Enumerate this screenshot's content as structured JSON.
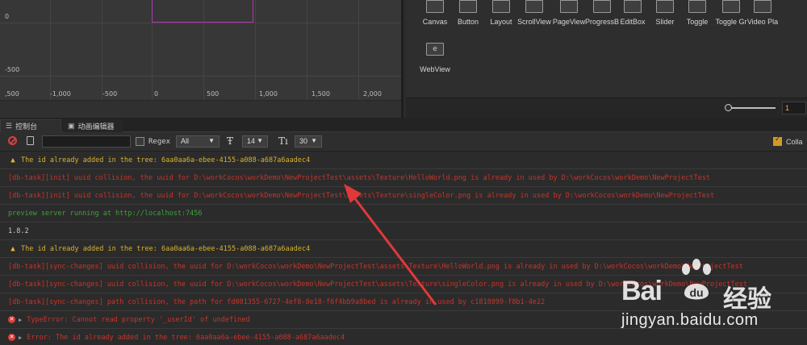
{
  "scene": {
    "ruler_y": [
      "0",
      "-500"
    ],
    "ruler_x": [
      ",500",
      "-1,000",
      "-500",
      "0",
      "500",
      "1,000",
      "1,500",
      "2,000"
    ]
  },
  "library": {
    "widgets": [
      {
        "label": "Canvas",
        "icon": "canvas-icon"
      },
      {
        "label": "Button",
        "icon": "button-icon"
      },
      {
        "label": "Layout",
        "icon": "layout-icon"
      },
      {
        "label": "ScrollView",
        "icon": "scrollview-icon"
      },
      {
        "label": "PageView",
        "icon": "pageview-icon"
      },
      {
        "label": "ProgressB",
        "icon": "progressbar-icon"
      },
      {
        "label": "EditBox",
        "icon": "editbox-icon"
      },
      {
        "label": "Slider",
        "icon": "slider-icon"
      },
      {
        "label": "Toggle",
        "icon": "toggle-icon"
      },
      {
        "label": "Toggle Gr",
        "icon": "toggle-group-icon"
      },
      {
        "label": "Video Pla",
        "icon": "videoplayer-icon"
      },
      {
        "label": "WebView",
        "icon": "webview-icon"
      }
    ],
    "zoom_value": "1"
  },
  "tabs": {
    "console": "控制台",
    "animation": "动画编辑器"
  },
  "toolbar": {
    "filter_value": "",
    "regex_label": "Regex",
    "level": "All",
    "font_size": "14",
    "line_height": "30",
    "collapse_label": "Colla"
  },
  "logs": [
    {
      "type": "warn",
      "text": "The id already added in the tree: 6aa0aa6a-ebee-4155-a088-a687a6aadec4"
    },
    {
      "type": "err",
      "text": "[db-task][init] uuid collision, the uuid for D:\\workCocos\\workDemo\\NewProjectTest\\assets\\Texture\\HelloWorld.png is already in used by D:\\workCocos\\workDemo\\NewProjectTest"
    },
    {
      "type": "err",
      "text": "[db-task][init] uuid collision, the uuid for D:\\workCocos\\workDemo\\NewProjectTest\\assets\\Texture\\singleColor.png is already in used by D:\\workCocos\\workDemo\\NewProjectTest"
    },
    {
      "type": "ok",
      "text": "preview server running at http://localhost:7456"
    },
    {
      "type": "info",
      "text": "1.8.2"
    },
    {
      "type": "warn",
      "text": "The id already added in the tree: 6aa0aa6a-ebee-4155-a088-a687a6aadec4"
    },
    {
      "type": "err",
      "text": "[db-task][sync-changes] uuid collision, the uuid for D:\\workCocos\\workDemo\\NewProjectTest\\assets\\Texture\\HelloWorld.png is already in used by D:\\workCocos\\workDemo\\NewProjectTest"
    },
    {
      "type": "err",
      "text": "[db-task][sync-changes] uuid collision, the uuid for D:\\workCocos\\workDemo\\NewProjectTest\\assets\\Texture\\singleColor.png is already in used by D:\\workCocos\\workDemo\\NewProjectTest"
    },
    {
      "type": "err",
      "text": "[db-task][sync-changes] path collision, the path for fd081355-6727-4ef8-8e18-f6f4bb9a8bed is already in used by c1818899-f8b1-4e22"
    },
    {
      "type": "exc",
      "text": "TypeError: Cannot read property '_userId' of undefined"
    },
    {
      "type": "exc",
      "text": "Error: The id already added in the tree: 6aa0aa6a-ebee-4155-a088-a687a6aadec4"
    }
  ],
  "watermark": {
    "brand_a": "Bai",
    "brand_b": "经验",
    "url": "jingyan.baidu.com"
  },
  "colors": {
    "warning": "#d9b22d",
    "error": "#c8342b",
    "success": "#3aa33a",
    "arrow": "#e0393a",
    "canvas_outline": "#b03ab0"
  }
}
